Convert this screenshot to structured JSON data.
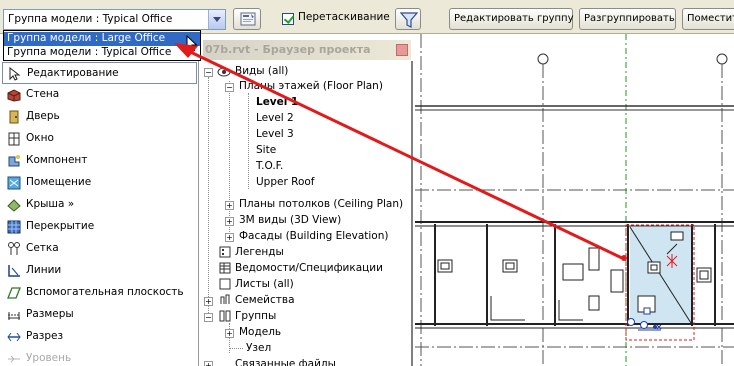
{
  "toolbar": {
    "group_combo_value": "Группа модели : Typical Office",
    "drag_label": "Перетаскивание",
    "drag_checked": true,
    "edit_group_label": "Редактировать группу",
    "ungroup_label": "Разгруппировать",
    "place_label": "Поместить"
  },
  "dropdown": {
    "options": [
      "Группа модели : Large Office",
      "Группа модели : Typical Office"
    ],
    "highlighted_index": 0
  },
  "tools": [
    {
      "label": "Редактирование",
      "icon": "pointer-icon"
    },
    {
      "label": "Стена",
      "icon": "wall-icon"
    },
    {
      "label": "Дверь",
      "icon": "door-icon"
    },
    {
      "label": "Окно",
      "icon": "window-icon"
    },
    {
      "label": "Компонент",
      "icon": "component-icon"
    },
    {
      "label": "Помещение",
      "icon": "room-icon"
    },
    {
      "label": "Крыша »",
      "icon": "roof-icon"
    },
    {
      "label": "Перекрытие",
      "icon": "floor-icon"
    },
    {
      "label": "Сетка",
      "icon": "grid-icon"
    },
    {
      "label": "Линии",
      "icon": "lines-icon"
    },
    {
      "label": "Вспомогательная плоскость",
      "icon": "ref-plane-icon"
    },
    {
      "label": "Размеры",
      "icon": "dimension-icon"
    },
    {
      "label": "Разрез",
      "icon": "section-icon"
    },
    {
      "label": "Уровень",
      "icon": "level-icon"
    }
  ],
  "browser": {
    "title": "07b.rvt - Браузер проекта",
    "tree": {
      "views": "Виды (all)",
      "floor_plans": "Планы этажей (Floor Plan)",
      "levels": [
        "Level 1",
        "Level 2",
        "Level 3",
        "Site",
        "T.O.F.",
        "Upper Roof"
      ],
      "ceiling_plans": "Планы потолков (Ceiling Plan)",
      "views_3d": "3М виды (3D View)",
      "elevations": "Фасады (Building Elevation)",
      "legends": "Легенды",
      "schedules": "Ведомости/Спецификации",
      "sheets": "Листы (all)",
      "families": "Семейства",
      "groups": "Группы",
      "model": "Модель",
      "detail": "Узел",
      "links": "Связанные файлы"
    }
  },
  "colors": {
    "highlight": "#316ac5",
    "annotation": "#e11b1b",
    "toolbar_bg": "#ece9d8",
    "selection_fill": "#cfe6f2"
  }
}
